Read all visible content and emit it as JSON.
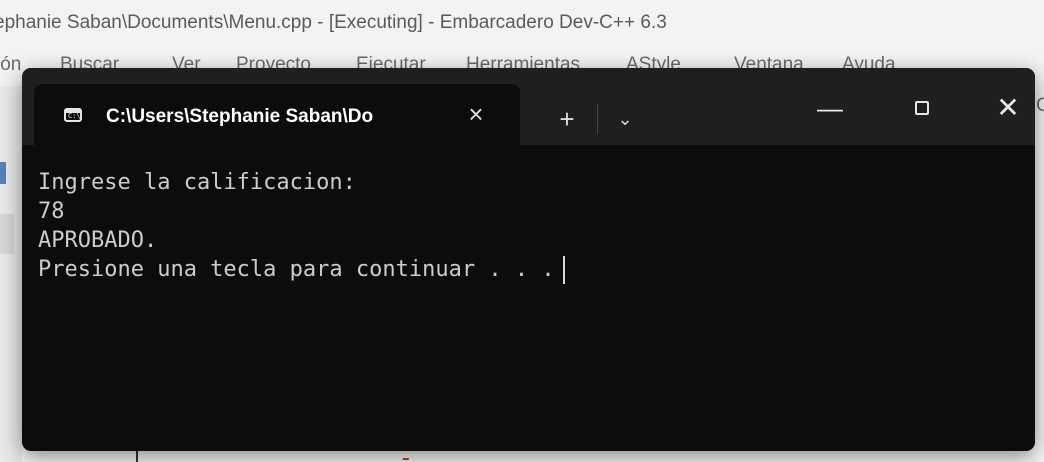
{
  "ide": {
    "title": "ephanie Saban\\Documents\\Menu.cpp - [Executing] - Embarcadero Dev-C++ 6.3",
    "menu": [
      "ión",
      "Buscar",
      "Ver",
      "Proyecto",
      "Ejecutar",
      "Herramientas",
      "AStyle",
      "Ventana",
      "Ayuda"
    ],
    "right_glyph": "G"
  },
  "terminal": {
    "tab_title": "C:\\Users\\Stephanie Saban\\Do",
    "tab_icon": "console-icon",
    "tab_icon_text": "C:\\",
    "close_tab_glyph": "×",
    "new_tab_glyph": "+",
    "dropdown_glyph": "⌄",
    "minimize_glyph": "—",
    "close_glyph": "✕",
    "output_lines": [
      "Ingrese la calificacion:",
      "78",
      "APROBADO.",
      "Presione una tecla para continuar . . ."
    ]
  }
}
